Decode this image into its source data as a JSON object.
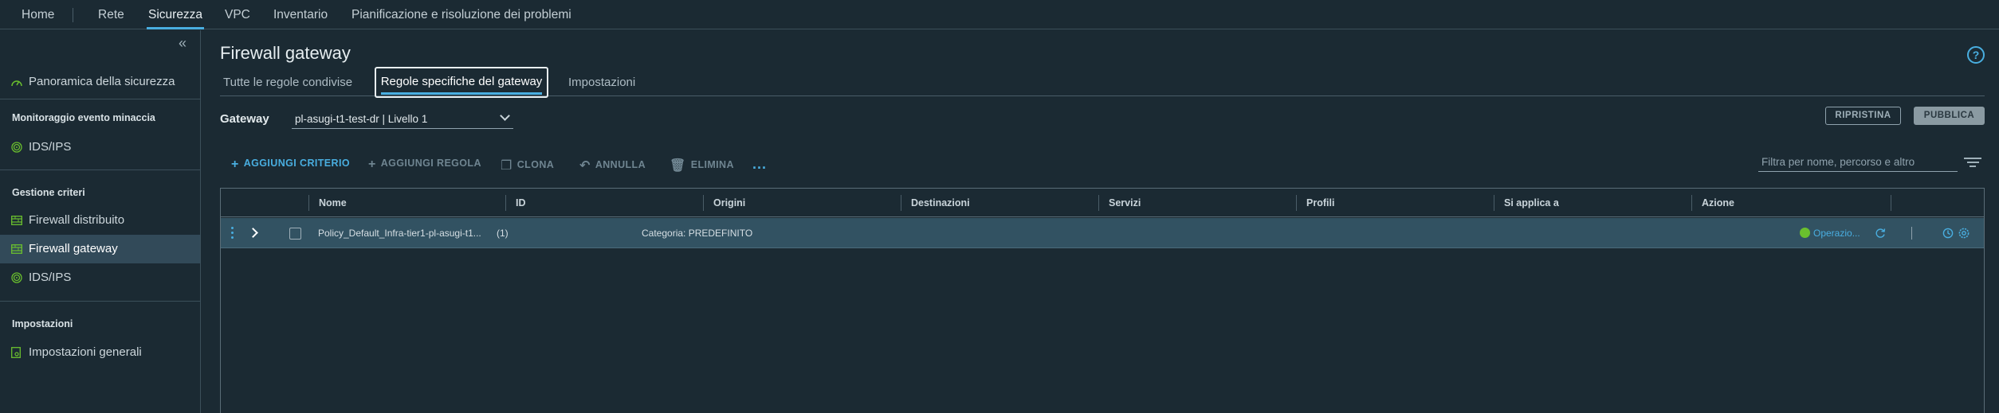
{
  "nav": {
    "home": "Home",
    "items": [
      {
        "label": "Rete"
      },
      {
        "label": "Sicurezza"
      },
      {
        "label": "VPC"
      },
      {
        "label": "Inventario"
      },
      {
        "label": "Pianificazione e risoluzione dei problemi"
      }
    ],
    "active": "Sicurezza"
  },
  "sidebar": {
    "collapse_glyph": "«",
    "overview": "Panoramica della sicurezza",
    "section_threat": "Monitoraggio evento minaccia",
    "ids_ips_1": "IDS/IPS",
    "section_rules": "Gestione criteri",
    "dfw": "Firewall distribuito",
    "gfw": "Firewall gateway",
    "ids_ips_2": "IDS/IPS",
    "section_settings": "Impostazioni",
    "general_settings": "Impostazioni generali"
  },
  "page": {
    "title": "Firewall gateway",
    "help": "?",
    "tabs": [
      {
        "label": "Tutte le regole condivise"
      },
      {
        "label": "Regole specifiche del gateway"
      },
      {
        "label": "Impostazioni"
      }
    ]
  },
  "gateway": {
    "label": "Gateway",
    "value": "pl-asugi-t1-test-dr | Livello 1"
  },
  "actions": {
    "revert": "RIPRISTINA",
    "publish": "PUBBLICA"
  },
  "toolbar": {
    "add_policy": "AGGIUNGI CRITERIO",
    "add_rule": "AGGIUNGI REGOLA",
    "clone": "CLONA",
    "undo": "ANNULLA",
    "delete": "ELIMINA",
    "more": "...",
    "filter_placeholder": "Filtra per nome, percorso e altro"
  },
  "table": {
    "columns": [
      "Nome",
      "ID",
      "Origini",
      "Destinazioni",
      "Servizi",
      "Profili",
      "Si applica a",
      "Azione"
    ],
    "rows": [
      {
        "name": "Policy_Default_Infra-tier1-pl-asugi-t1...",
        "count": "(1)",
        "category": "Categoria: PREDEFINITO",
        "status": "Operazio..."
      }
    ]
  },
  "colors": {
    "accent": "#49aee0",
    "background": "#1b2a33",
    "selected_row": "#325262",
    "success": "#6abf2e"
  }
}
